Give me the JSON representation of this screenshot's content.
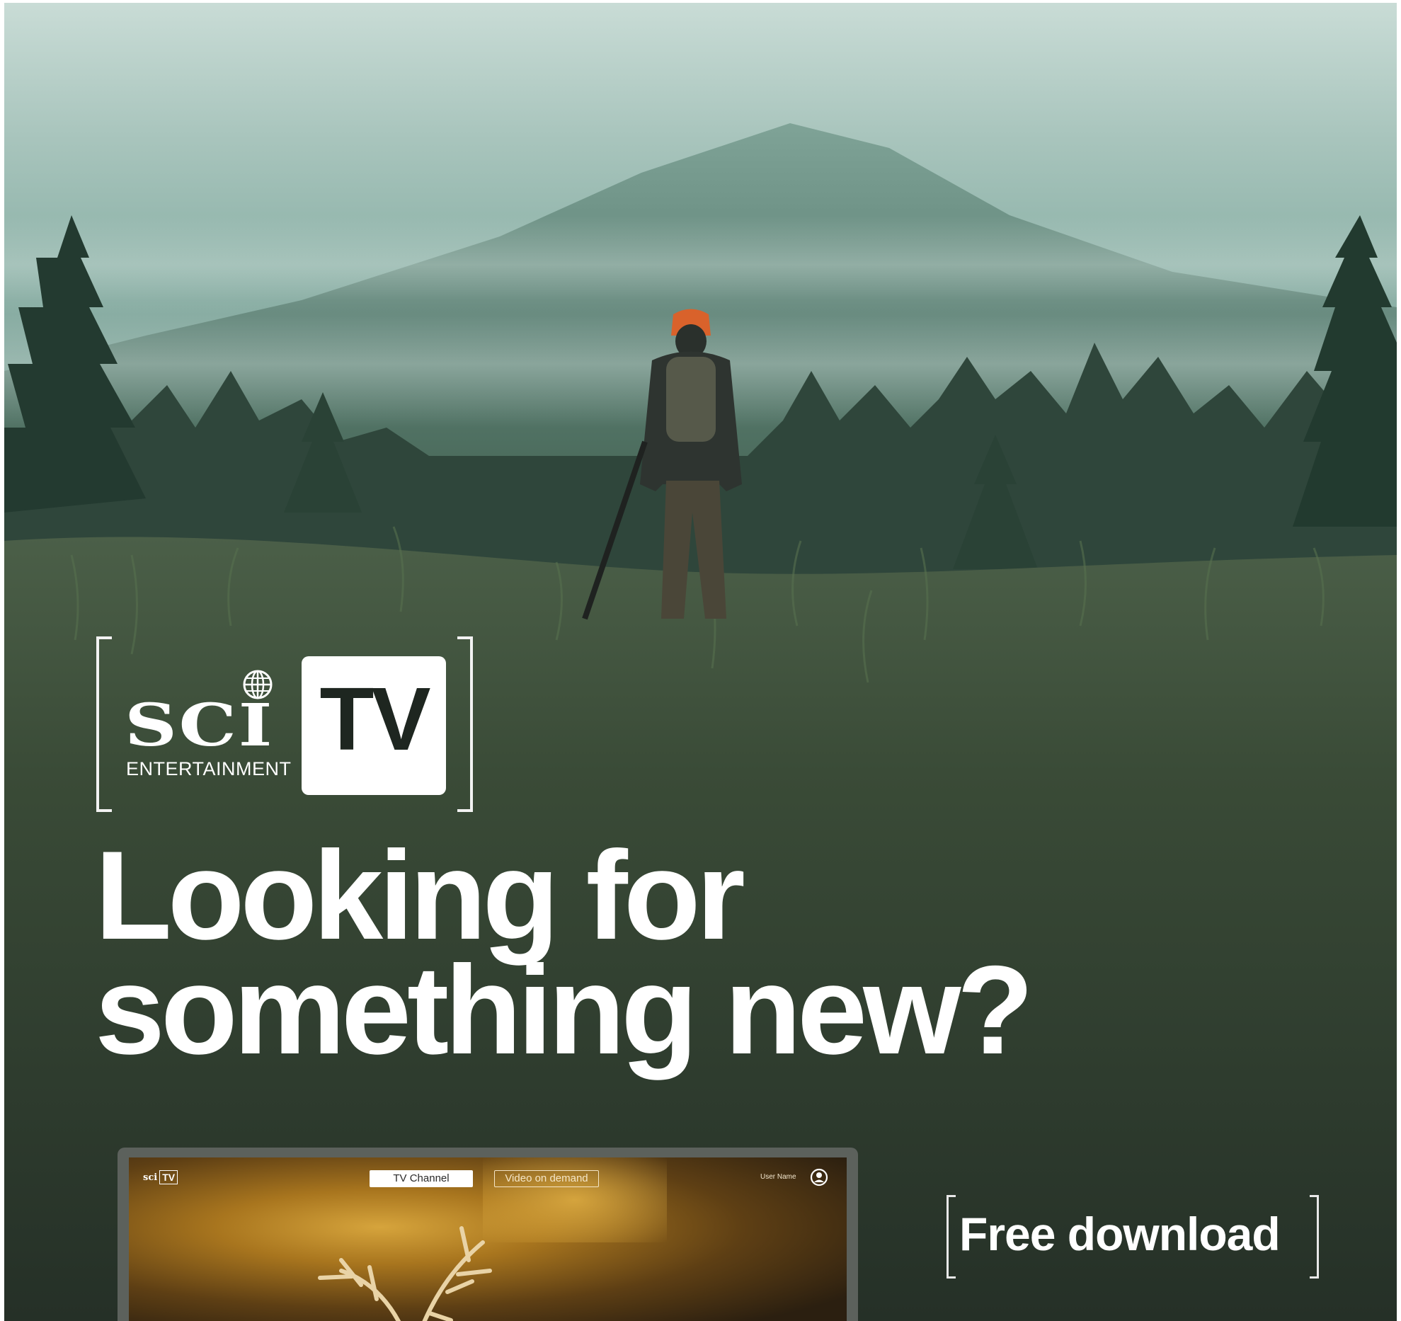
{
  "logo": {
    "brand": "SCI",
    "subtitle": "ENTERTAINMENT",
    "badge": "TV"
  },
  "headline": {
    "line1": "Looking for",
    "line2": "something new?"
  },
  "device": {
    "logo_brand": "sci",
    "logo_badge": "TV",
    "nav_tv_channel": "TV Channel",
    "nav_vod": "Video on demand",
    "user_name": "User Name"
  },
  "cta": {
    "download_label": "Free download"
  },
  "colors": {
    "sky": "#c9dcd6",
    "forest": "#2b3a2e",
    "cap": "#d9622b",
    "accent_text": "#ffffff"
  }
}
